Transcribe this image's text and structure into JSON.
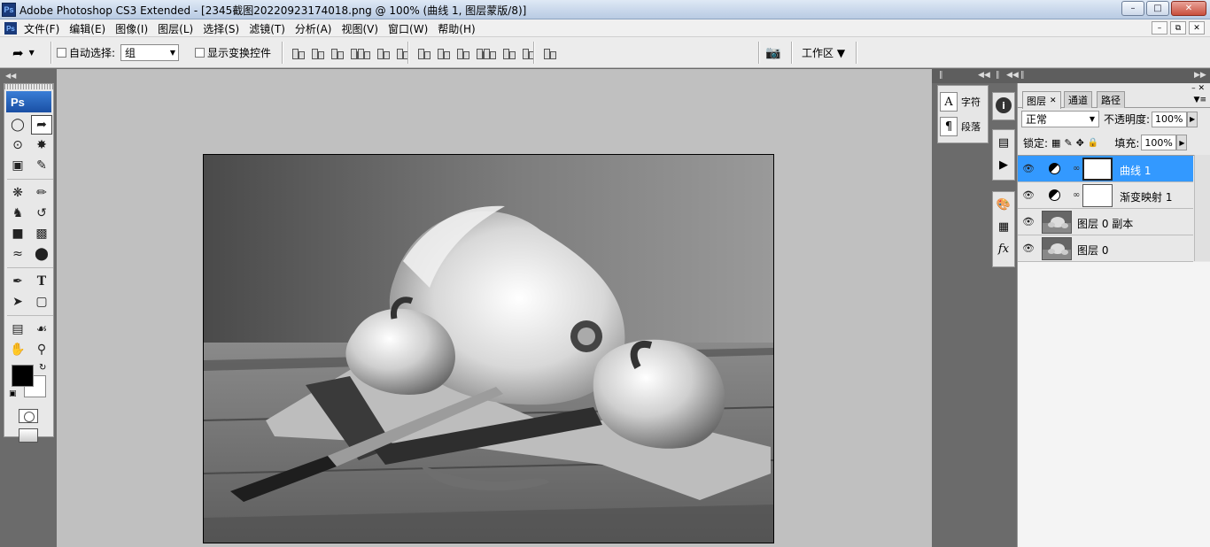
{
  "window": {
    "app_badge": "Ps",
    "title": "Adobe Photoshop CS3 Extended - [2345截图20220923174018.png @ 100% (曲线 1, 图层蒙版/8)]",
    "controls": [
      "–",
      "□",
      "✕"
    ]
  },
  "menubar": {
    "items": [
      "文件(F)",
      "编辑(E)",
      "图像(I)",
      "图层(L)",
      "选择(S)",
      "滤镜(T)",
      "分析(A)",
      "视图(V)",
      "窗口(W)",
      "帮助(H)"
    ],
    "doc_controls": [
      "–",
      "⧉",
      "✕"
    ]
  },
  "options": {
    "auto_select_label": "自动选择:",
    "auto_select_value": "组",
    "show_transform_label": "显示变换控件",
    "workspace_label": "工作区 ▼"
  },
  "toolbox": {
    "logo": "Ps"
  },
  "minipanel": {
    "character_label": "字符",
    "paragraph_label": "段落"
  },
  "layers_panel": {
    "tabs": [
      "图层",
      "通道",
      "路径"
    ],
    "blend_mode": "正常",
    "opacity_label": "不透明度:",
    "opacity_value": "100%",
    "lock_label": "锁定:",
    "fill_label": "填充:",
    "fill_value": "100%",
    "layers": [
      {
        "name": "曲线 1",
        "type": "adjustment",
        "selected": true
      },
      {
        "name": "渐变映射 1",
        "type": "adjustment",
        "selected": false
      },
      {
        "name": "图层 0 副本",
        "type": "pixel",
        "selected": false
      },
      {
        "name": "图层 0",
        "type": "pixel",
        "selected": false
      }
    ]
  },
  "colors": {
    "foreground": "#000000",
    "background": "#ffffff",
    "selection": "#3399ff"
  }
}
